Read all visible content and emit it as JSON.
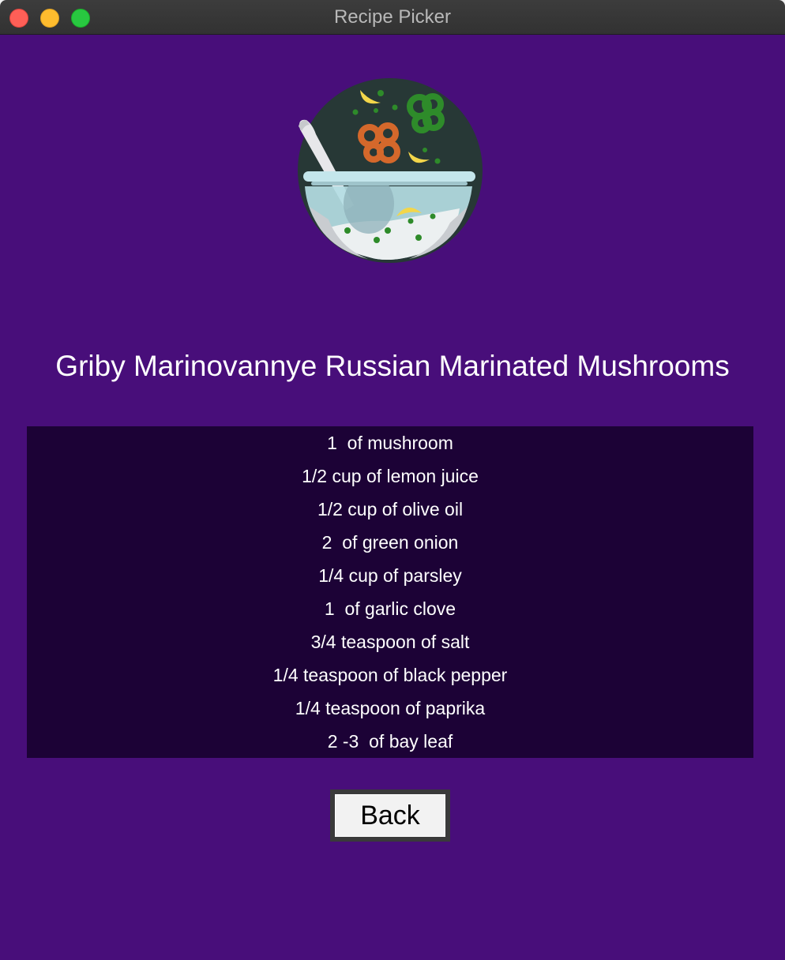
{
  "window": {
    "title": "Recipe Picker"
  },
  "logo": {
    "icon": "salad-bowl-icon"
  },
  "recipe": {
    "title": "Griby Marinovannye Russian Marinated Mushrooms",
    "ingredients": [
      "1  of mushroom",
      "1/2 cup of lemon juice",
      "1/2 cup of olive oil",
      "2  of green onion",
      "1/4 cup of parsley",
      "1  of garlic clove",
      "3/4 teaspoon of salt",
      "1/4 teaspoon of black pepper",
      "1/4 teaspoon of paprika",
      "2 -3  of bay leaf"
    ]
  },
  "buttons": {
    "back_label": "Back"
  },
  "colors": {
    "background": "#480e7a",
    "ingredients_background": "#1c0236",
    "text": "#ffffff"
  }
}
